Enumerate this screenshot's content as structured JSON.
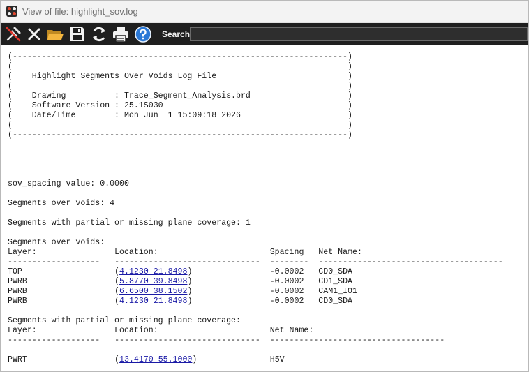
{
  "window": {
    "title": "View of file: highlight_sov.log"
  },
  "toolbar": {
    "buttons": [
      {
        "name": "pin-button",
        "icon": "pin-icon",
        "tooltip": "Pin"
      },
      {
        "name": "close-button",
        "icon": "close-icon",
        "tooltip": "Close"
      },
      {
        "name": "open-button",
        "icon": "folder-icon",
        "tooltip": "Open"
      },
      {
        "name": "save-button",
        "icon": "save-icon",
        "tooltip": "Save"
      },
      {
        "name": "refresh-button",
        "icon": "refresh-icon",
        "tooltip": "Refresh"
      },
      {
        "name": "print-button",
        "icon": "printer-icon",
        "tooltip": "Print"
      },
      {
        "name": "help-button",
        "icon": "help-icon",
        "tooltip": "Help"
      }
    ],
    "search_label": "Search:",
    "search_value": ""
  },
  "log": {
    "header_lines": [
      "(---------------------------------------------------------------------)",
      "(                                                                     )",
      "(    Highlight Segments Over Voids Log File                           )",
      "(                                                                     )",
      "(    Drawing          : Trace_Segment_Analysis.brd                    )",
      "(    Software Version : 25.1S030                                      )",
      "(    Date/Time        : Mon Jun  1 15:09:18 2026                      )",
      "(                                                                     )",
      "(---------------------------------------------------------------------)"
    ],
    "spacing_line": "sov_spacing value: 0.0000",
    "count_line": "Segments over voids: 4",
    "partial_count_line": "Segments with partial or missing plane coverage: 1",
    "voids_section": {
      "title": "Segments over voids:",
      "header_layer": "Layer:",
      "header_location": "Location:",
      "header_spacing": "Spacing",
      "header_net": "Net Name:",
      "rule_layer": "-------------------",
      "rule_location": "------------------------------",
      "rule_spacing": "--------",
      "rule_net": "--------------------------------------",
      "rows": [
        {
          "layer": "TOP",
          "location": "4.1230 21.8498",
          "spacing": "-0.0002",
          "net": "CD0_SDA"
        },
        {
          "layer": "PWRB",
          "location": "5.8770 39.8498",
          "spacing": "-0.0002",
          "net": "CD1_SDA"
        },
        {
          "layer": "PWRB",
          "location": "6.6500 38.1502",
          "spacing": "-0.0002",
          "net": "CAM1_IO1"
        },
        {
          "layer": "PWRB",
          "location": "4.1230 21.8498",
          "spacing": "-0.0002",
          "net": "CD0_SDA"
        }
      ]
    },
    "partial_section": {
      "title": "Segments with partial or missing plane coverage:",
      "header_layer": "Layer:",
      "header_location": "Location:",
      "header_net": "Net Name:",
      "rule_layer": "-------------------",
      "rule_location": "------------------------------",
      "rule_net": "------------------------------------",
      "rows": [
        {
          "layer": "PWRT",
          "location": "13.4170 55.1000",
          "net": "H5V"
        }
      ]
    }
  }
}
